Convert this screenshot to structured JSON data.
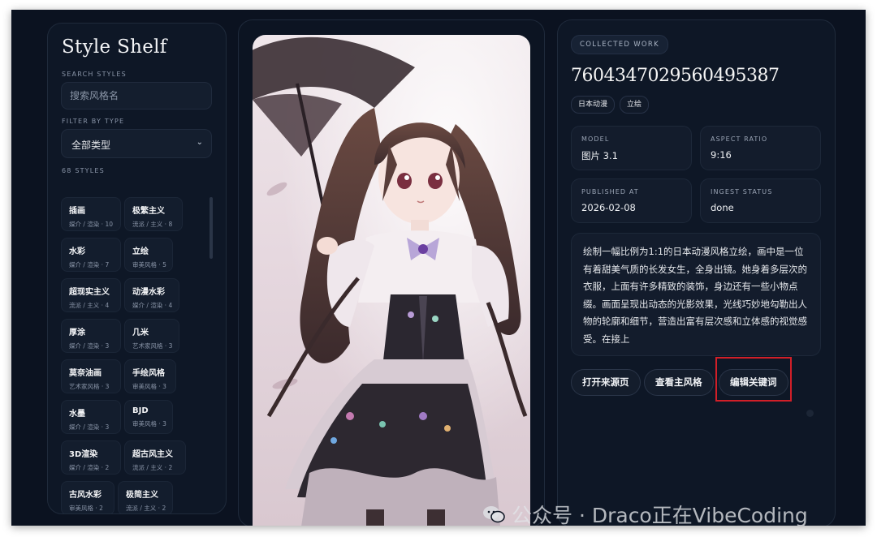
{
  "sidebar": {
    "brand": "Style Shelf",
    "search_label": "SEARCH STYLES",
    "search_placeholder": "搜索风格名",
    "filter_label": "FILTER BY TYPE",
    "filter_value": "全部类型",
    "count_label": "68 STYLES",
    "styles": [
      {
        "name": "插画",
        "meta": "媒介 / 渲染 · 10"
      },
      {
        "name": "极繁主义",
        "meta": "流派 / 主义 · 8"
      },
      {
        "name": "水彩",
        "meta": "媒介 / 渲染 · 7"
      },
      {
        "name": "立绘",
        "meta": "审美风格 · 5"
      },
      {
        "name": "超现实主义",
        "meta": "流派 / 主义 · 4"
      },
      {
        "name": "动漫水彩",
        "meta": "媒介 / 渲染 · 4"
      },
      {
        "name": "厚涂",
        "meta": "媒介 / 渲染 · 3"
      },
      {
        "name": "几米",
        "meta": "艺术家风格 · 3"
      },
      {
        "name": "莫奈油画",
        "meta": "艺术家风格 · 3"
      },
      {
        "name": "手绘风格",
        "meta": "审美风格 · 3"
      },
      {
        "name": "水墨",
        "meta": "媒介 / 渲染 · 3"
      },
      {
        "name": "BJD",
        "meta": "审美风格 · 3"
      },
      {
        "name": "3D渲染",
        "meta": "媒介 / 渲染 · 2"
      },
      {
        "name": "超古风主义",
        "meta": "流派 / 主义 · 2"
      },
      {
        "name": "古风水彩",
        "meta": "审美风格 · 2"
      },
      {
        "name": "极简主义",
        "meta": "流派 / 主义 · 2"
      }
    ]
  },
  "preview": {
    "image_icon": "anime-illustration-image"
  },
  "detail": {
    "badge": "COLLECTED WORK",
    "id": "7604347029560495387",
    "tags": [
      "日本动漫",
      "立绘"
    ],
    "model_label": "MODEL",
    "model": "图片 3.1",
    "aspect_label": "ASPECT RATIO",
    "aspect": "9:16",
    "published_label": "PUBLISHED AT",
    "published": "2026-02-08",
    "ingest_label": "INGEST STATUS",
    "ingest": "done",
    "description": "绘制一幅比例为1:1的日本动漫风格立绘，画中是一位有着甜美气质的长发女生，全身出镜。她身着多层次的衣服，上面有许多精致的装饰，身边还有一些小物点缀。画面呈现出动态的光影效果，光线巧妙地勾勒出人物的轮廓和细节，营造出富有层次感和立体感的视觉感受。在接上",
    "buttons": {
      "open_source": "打开来源页",
      "view_style": "查看主风格",
      "edit_keywords": "编辑关键词"
    }
  },
  "watermark": "公众号 · Draco正在VibeCoding",
  "colors": {
    "background": "#0b1220",
    "panel": "#0e1726",
    "highlight": "#d11f28"
  }
}
